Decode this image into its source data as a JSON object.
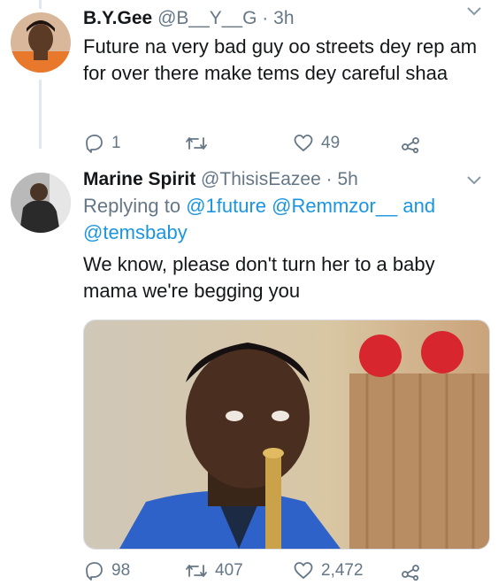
{
  "tweets": [
    {
      "name": "B.Y.Gee",
      "handle": "@B__Y__G",
      "separator": "·",
      "time": "3h",
      "text": "Future na very bad guy oo streets dey rep am for over there make tems dey careful shaa",
      "reply_count": "1",
      "retweet_count": "",
      "like_count": "49"
    },
    {
      "name": "Marine Spirit",
      "handle": "@ThisisEazee",
      "separator": "·",
      "time": "5h",
      "replying_prefix": "Replying to",
      "mention_1": "@1future",
      "mention_2": "@Remmzor__",
      "and_word": "and",
      "mention_3": "@temsbaby",
      "text": "We know, please don't turn her to a baby mama we're begging you",
      "reply_count": "98",
      "retweet_count": "407",
      "like_count": "2,472"
    }
  ],
  "colors": {
    "text_primary": "#14171a",
    "text_secondary": "#657786",
    "link": "#1b95e0",
    "divider": "#e1e8ed"
  },
  "icons": [
    "reply-icon",
    "retweet-icon",
    "like-icon",
    "share-icon",
    "chevron-down-icon"
  ]
}
